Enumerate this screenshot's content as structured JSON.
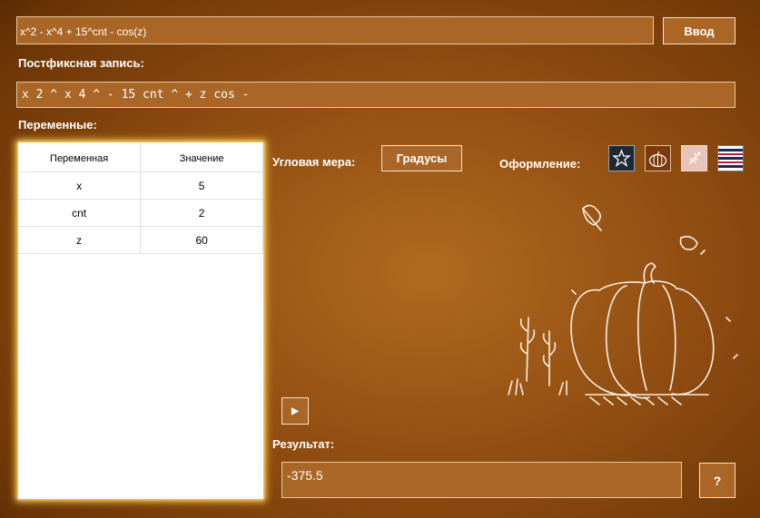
{
  "expression": {
    "value": "x^2 - x^4 + 15^cnt - cos(z)"
  },
  "enter_button": {
    "label": "Ввод"
  },
  "postfix": {
    "label": "Постфиксная запись:",
    "value": "x 2 ^ x 4 ^ - 15 cnt ^ + z cos -"
  },
  "variables": {
    "label": "Переменные:",
    "columns": [
      "Переменная",
      "Значение"
    ],
    "rows": [
      {
        "name": "x",
        "value": "5"
      },
      {
        "name": "cnt",
        "value": "2"
      },
      {
        "name": "z",
        "value": "60"
      }
    ]
  },
  "angle": {
    "label": "Угловая мера:",
    "button": "Градусы"
  },
  "theme": {
    "label": "Оформление:",
    "options": [
      "star-theme-icon",
      "pumpkin-theme-icon",
      "floral-theme-icon",
      "stripes-theme-icon"
    ]
  },
  "play_button": {
    "icon": "play-icon",
    "glyph": "▶"
  },
  "result": {
    "label": "Результат:",
    "value": "-375.5"
  },
  "help_button": {
    "label": "?"
  },
  "colors": {
    "background": "#934f12",
    "field": "#a96626",
    "glow": "#f5c24a"
  }
}
